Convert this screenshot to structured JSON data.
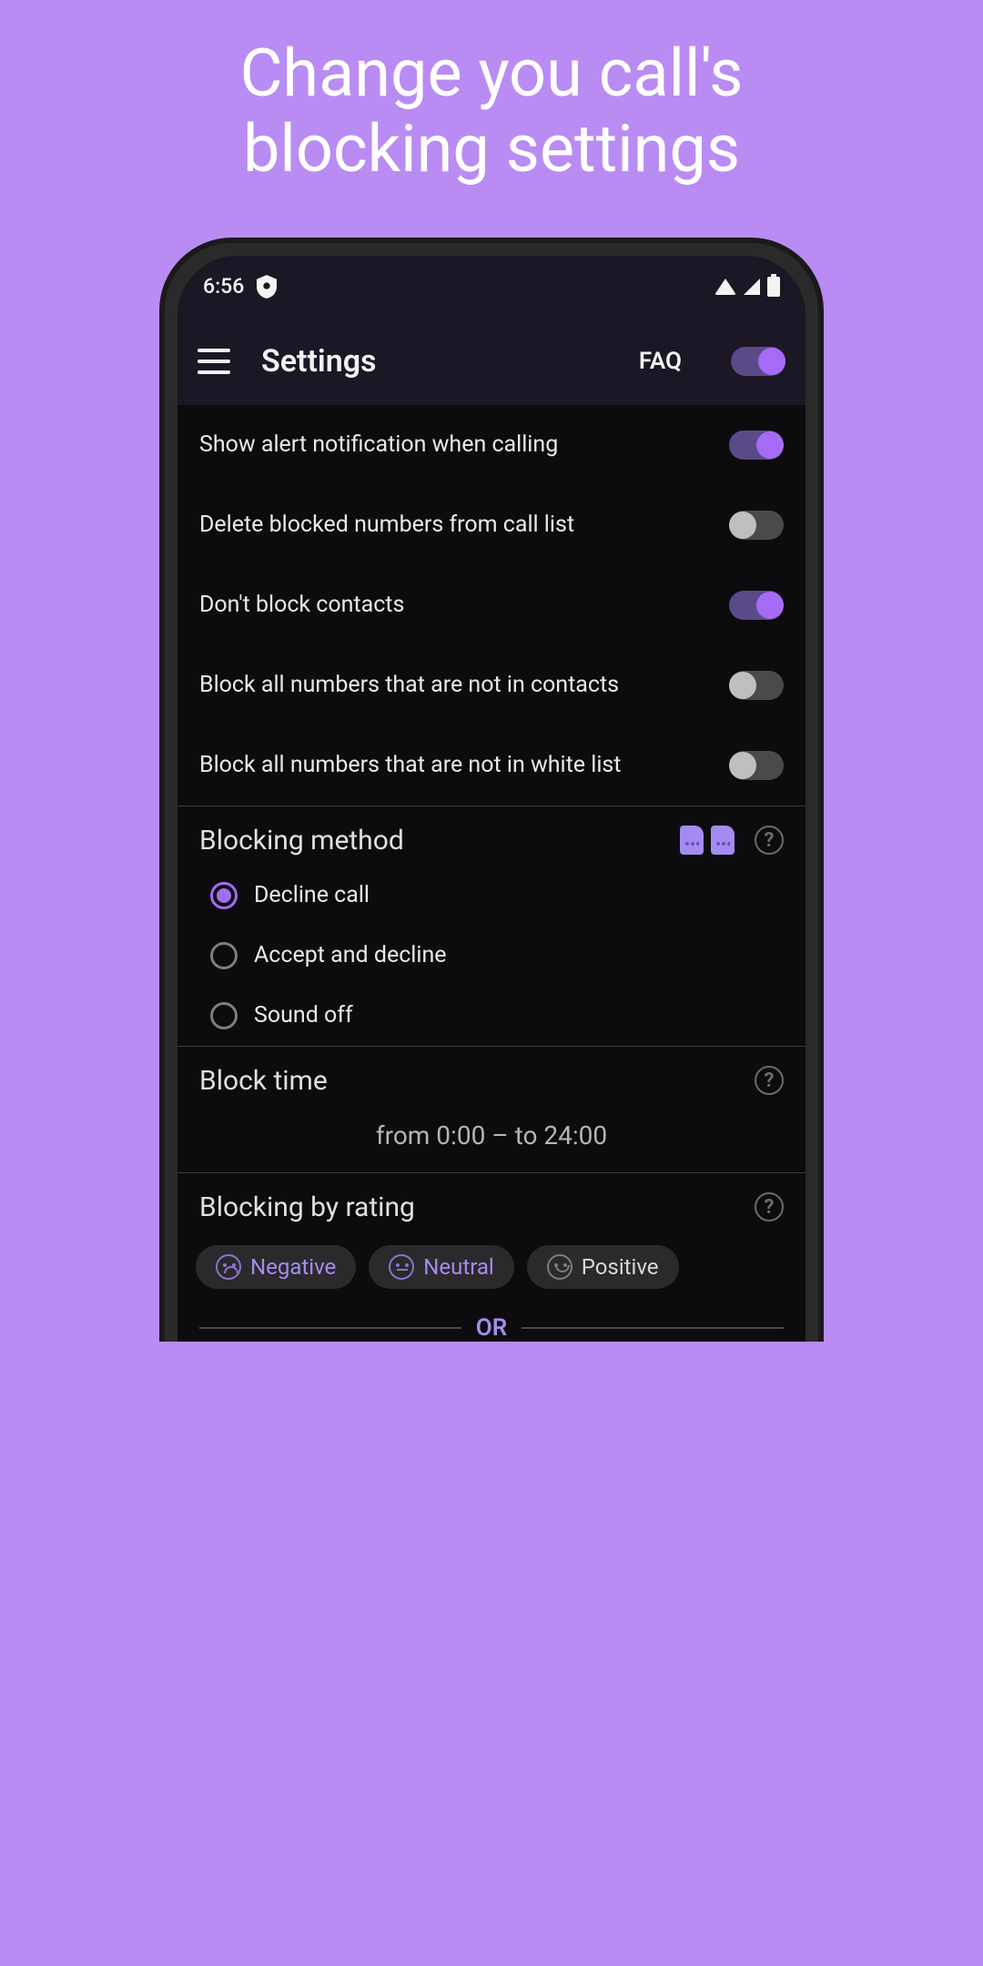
{
  "promo": {
    "line1": "Change you call's",
    "line2": "blocking settings"
  },
  "statusbar": {
    "time": "6:56"
  },
  "appbar": {
    "title": "Settings",
    "faq": "FAQ",
    "master_toggle": true
  },
  "settings": [
    {
      "label": "Show alert notification when calling",
      "on": true
    },
    {
      "label": "Delete blocked numbers from call list",
      "on": false
    },
    {
      "label": "Don't block contacts",
      "on": true
    },
    {
      "label": "Block all numbers that are not in contacts",
      "on": false
    },
    {
      "label": "Block all numbers that are not in white list",
      "on": false
    }
  ],
  "blocking_method": {
    "title": "Blocking method",
    "options": [
      {
        "label": "Decline call",
        "selected": true
      },
      {
        "label": "Accept and decline",
        "selected": false
      },
      {
        "label": "Sound off",
        "selected": false
      }
    ]
  },
  "block_time": {
    "title": "Block time",
    "value": "from 0:00 – to 24:00"
  },
  "blocking_by_rating": {
    "title": "Blocking by rating",
    "chips": [
      {
        "label": "Negative",
        "mood": "sad",
        "active": true
      },
      {
        "label": "Neutral",
        "mood": "neu",
        "active": true
      },
      {
        "label": "Positive",
        "mood": "pos",
        "active": false
      }
    ],
    "or": "OR"
  },
  "colors": {
    "accent": "#a66bf5",
    "bg": "#0c0c0e",
    "promo_bg": "#b98cf3"
  }
}
